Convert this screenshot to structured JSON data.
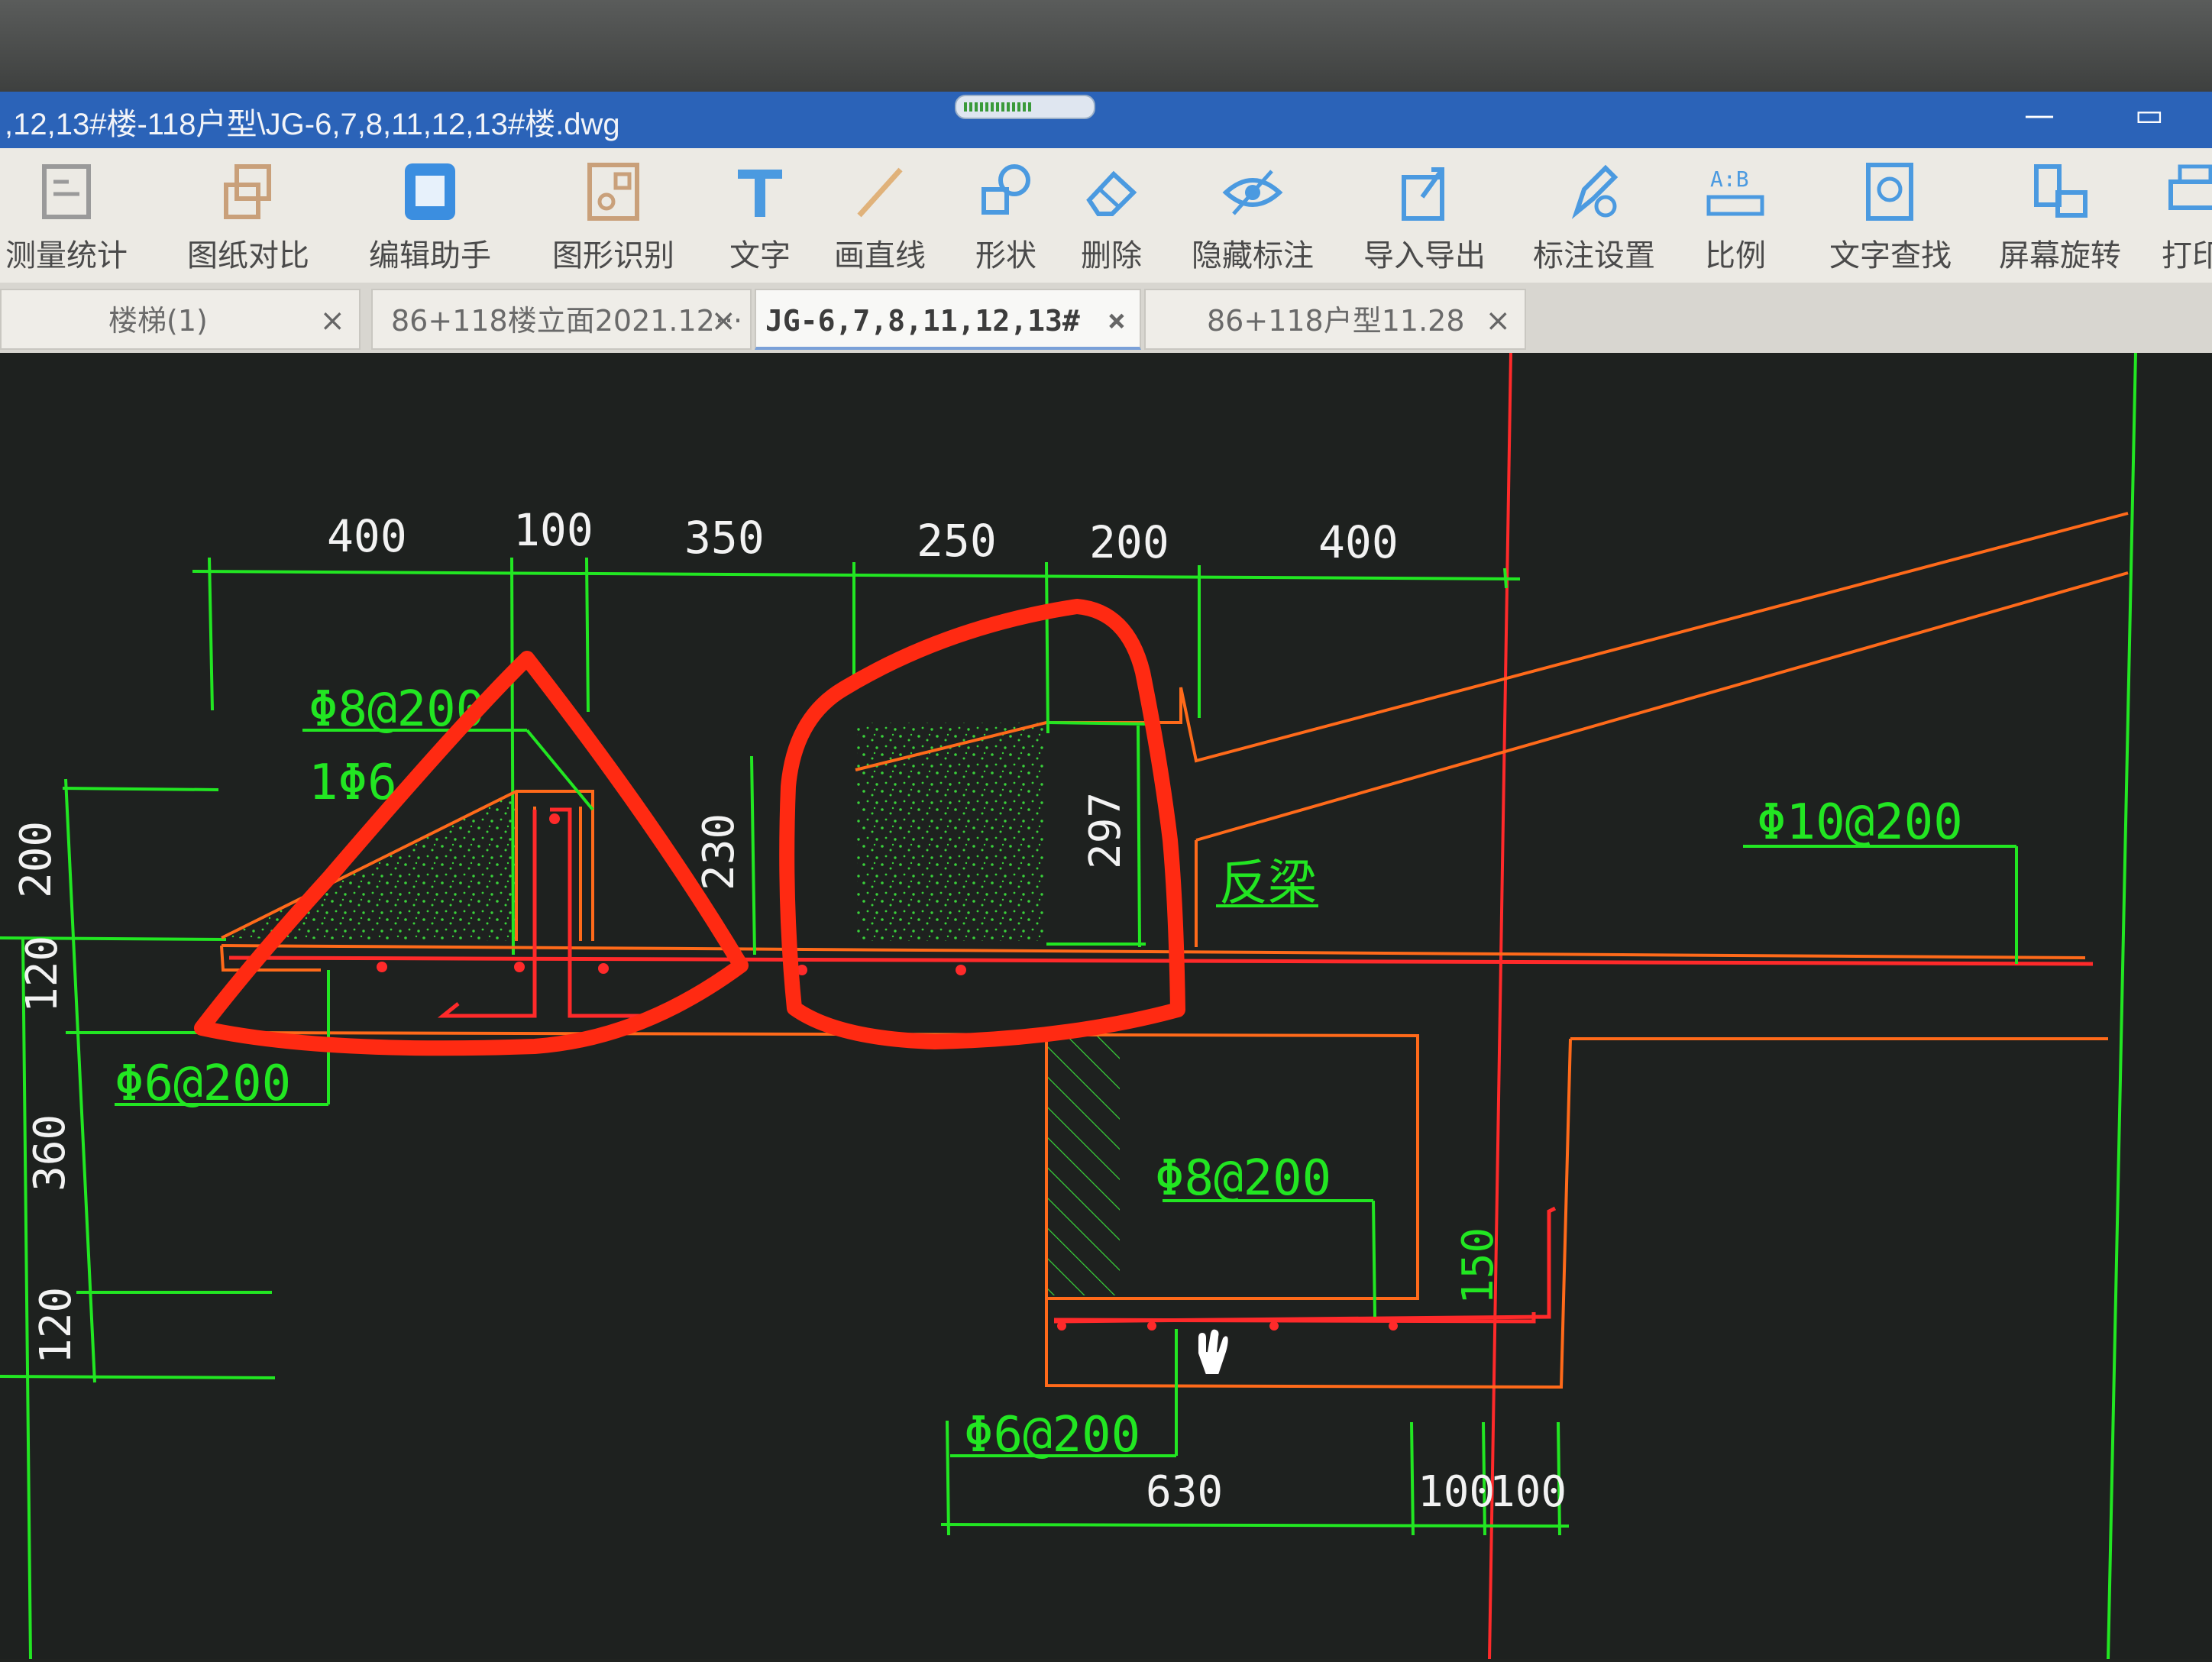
{
  "window": {
    "title": ",12,13#楼-118户型\\JG-6,7,8,11,12,13#楼.dwg",
    "minimize": "—",
    "restore": "▭"
  },
  "toolbar": {
    "items": [
      {
        "label": "测量统计",
        "icon": "measure-icon"
      },
      {
        "label": "图纸对比",
        "icon": "compare-icon"
      },
      {
        "label": "编辑助手",
        "icon": "edit-assistant-icon"
      },
      {
        "label": "图形识别",
        "icon": "shape-recognition-icon"
      },
      {
        "label": "文字",
        "icon": "text-icon"
      },
      {
        "label": "画直线",
        "icon": "line-icon"
      },
      {
        "label": "形状",
        "icon": "shape-icon"
      },
      {
        "label": "删除",
        "icon": "eraser-icon"
      },
      {
        "label": "隐藏标注",
        "icon": "eye-icon"
      },
      {
        "label": "导入导出",
        "icon": "import-export-icon"
      },
      {
        "label": "标注设置",
        "icon": "annotation-settings-icon"
      },
      {
        "label": "比例",
        "icon": "scale-icon"
      },
      {
        "label": "文字查找",
        "icon": "text-search-icon"
      },
      {
        "label": "屏幕旋转",
        "icon": "rotate-screen-icon"
      },
      {
        "label": "打印",
        "icon": "print-icon"
      }
    ]
  },
  "tabs": [
    {
      "label": "楼梯(1)",
      "close": "×",
      "active": false
    },
    {
      "label": "86+118楼立面2021.12···",
      "close": "×",
      "active": false
    },
    {
      "label": "JG-6,7,8,11,12,13#",
      "close": "×",
      "active": true
    },
    {
      "label": "86+118户型11.28",
      "close": "×",
      "active": false
    }
  ],
  "drawing": {
    "top_dims": [
      "400",
      "100",
      "350",
      "250",
      "200",
      "400"
    ],
    "left_dims": [
      "200",
      "120",
      "360",
      "120"
    ],
    "dim_230": "230",
    "dim_297": "297",
    "rebar_labels": {
      "top_left": "Φ8@200",
      "top_left_2": "1Φ6",
      "bottom_left": "Φ6@200",
      "right_top": "Φ10@200",
      "center_mid": "Φ8@200",
      "center_bottom": "Φ6@200"
    },
    "beam_label": "反梁",
    "dim_150": "150",
    "bottom_dims": [
      "630",
      "100",
      "100"
    ],
    "colors": {
      "dimension": "#22e622",
      "outline": "#ff6a1a",
      "axis": "#ff2a2a",
      "annotation": "#ff2a12",
      "text": "#f2f2f2"
    }
  }
}
